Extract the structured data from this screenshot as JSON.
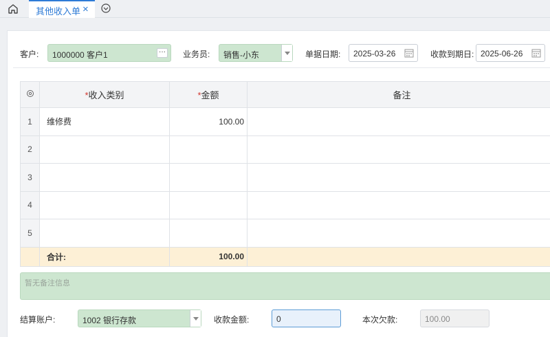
{
  "tabs": {
    "active_label": "其他收入单",
    "close_glyph": "×"
  },
  "header": {
    "customer_label": "客户:",
    "customer_value": "1000000 客户1",
    "salesperson_label": "业务员:",
    "salesperson_value": "销售-小东",
    "doc_date_label": "单据日期:",
    "doc_date_value": "2025-03-26",
    "due_date_label": "收款到期日:",
    "due_date_value": "2025-06-26",
    "more_glyph": "···"
  },
  "grid": {
    "columns": {
      "category": "收入类别",
      "amount": "金额",
      "note": "备注",
      "required_mark": "*"
    },
    "rows": [
      {
        "num": "1",
        "category": "维修费",
        "amount": "100.00",
        "note": ""
      },
      {
        "num": "2",
        "category": "",
        "amount": "",
        "note": ""
      },
      {
        "num": "3",
        "category": "",
        "amount": "",
        "note": ""
      },
      {
        "num": "4",
        "category": "",
        "amount": "",
        "note": ""
      },
      {
        "num": "5",
        "category": "",
        "amount": "",
        "note": ""
      }
    ],
    "total_label": "合计:",
    "total_amount": "100.00"
  },
  "remark": {
    "placeholder": "暂无备注信息"
  },
  "footer": {
    "account_label": "结算账户:",
    "account_value": "1002 银行存款",
    "received_label": "收款金额:",
    "received_value": "0",
    "owed_label": "本次欠款:",
    "owed_value": "100.00"
  },
  "icons": [
    "home-icon",
    "chevron-down-circle-icon",
    "calendar-icon",
    "settings-icon",
    "ellipsis-icon"
  ],
  "colors": {
    "accent": "#2e7bd6",
    "field_green": "#cde6d0",
    "total_row": "#fdf0d6",
    "required": "#d0342c"
  }
}
